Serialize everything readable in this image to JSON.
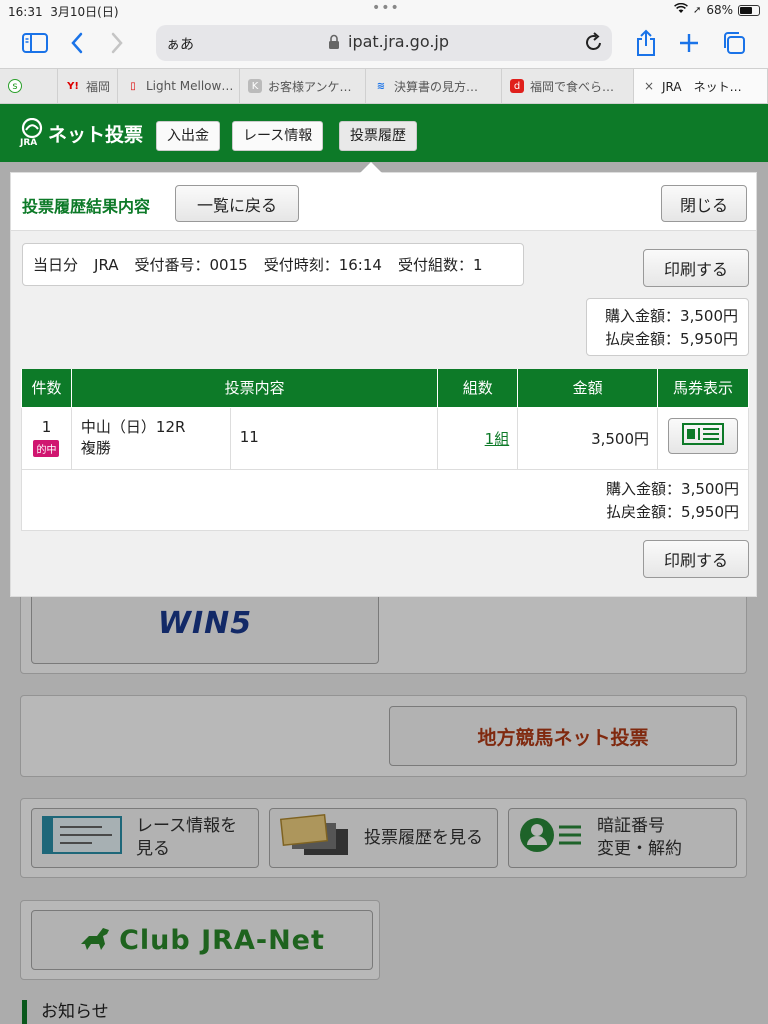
{
  "status": {
    "time": "16:31",
    "date": "3月10日(日)",
    "battery": "68%",
    "battery_level": 0.68
  },
  "browser": {
    "reader_label": "ぁあ",
    "domain": "ipat.jra.go.jp"
  },
  "tabs": [
    {
      "label": "",
      "icon": "s"
    },
    {
      "label": "福岡",
      "icon": "Y!"
    },
    {
      "label": "Light Mellow…",
      "icon": "▯"
    },
    {
      "label": "お客様アンケ…",
      "icon": "K"
    },
    {
      "label": "決算書の見方…",
      "icon": "≋"
    },
    {
      "label": "福岡で食べら…",
      "icon": "d"
    },
    {
      "label": "JRA　ネット…",
      "icon": "×"
    }
  ],
  "header": {
    "logo_text": "ネット投票",
    "logo_sub": "JRA",
    "nav": [
      "入出金",
      "レース情報",
      "投票履歴"
    ]
  },
  "modal": {
    "title": "投票履歴結果内容",
    "back_button": "一覧に戻る",
    "close_button": "閉じる",
    "print_button": "印刷する",
    "info": {
      "day": "当日分",
      "org": "JRA",
      "receipt_no": "受付番号：0015",
      "receipt_time": "受付時刻：16:14",
      "receipt_sets": "受付組数：1"
    },
    "summary": {
      "purchase": "購入金額：3,500円",
      "refund": "払戻金額：5,950円"
    },
    "table": {
      "headers": [
        "件数",
        "投票内容",
        "組数",
        "金額",
        "馬券表示"
      ],
      "rows": [
        {
          "count": "1",
          "badge": "的中",
          "race": "中山（日）12R",
          "type": "複勝",
          "selection": "11",
          "sets": "1組",
          "amount": "3,500円"
        }
      ]
    }
  },
  "background": {
    "win5": "WIN5",
    "chiho": "地方競馬ネット投票",
    "race_info": "レース情報を見る",
    "history": "投票履歴を見る",
    "pin_line1": "暗証番号",
    "pin_line2": "変更・解約",
    "club": "Club JRA-Net",
    "notice": "お知らせ"
  }
}
